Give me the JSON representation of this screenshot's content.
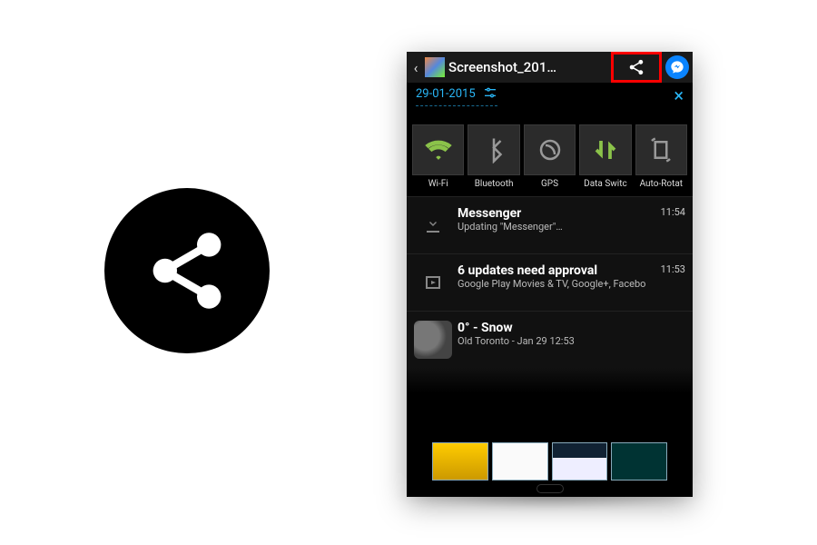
{
  "share_icon_name": "share-icon",
  "appbar": {
    "title": "Screenshot_201…",
    "highlight_label": "share-button-highlight"
  },
  "date_row": {
    "date": "29-01-2015"
  },
  "quick_settings": [
    {
      "id": "wifi",
      "label": "Wi-Fi",
      "active": true
    },
    {
      "id": "bt",
      "label": "Bluetooth",
      "active": false
    },
    {
      "id": "gps",
      "label": "GPS",
      "active": false
    },
    {
      "id": "data",
      "label": "Data Switc",
      "active": true
    },
    {
      "id": "rotate",
      "label": "Auto-Rotat",
      "active": false
    }
  ],
  "notifications": [
    {
      "icon": "download-icon",
      "title": "Messenger",
      "sub": "Updating \"Messenger\"…",
      "time": "11:54"
    },
    {
      "icon": "play-store-icon",
      "title": "6 updates need approval",
      "sub": "Google Play Movies & TV, Google+, Facebo",
      "time": "11:53"
    },
    {
      "icon": "weather-snow-icon",
      "title": "0° -  Snow",
      "sub": "Old Toronto - Jan 29  12:53",
      "time": ""
    }
  ]
}
